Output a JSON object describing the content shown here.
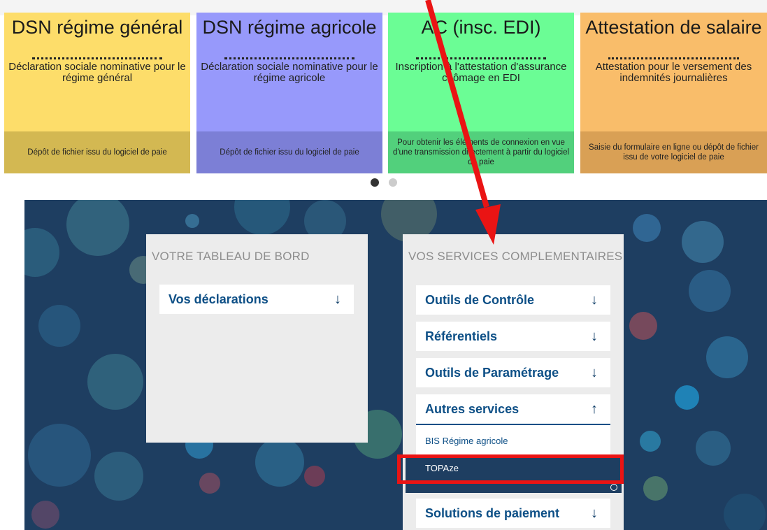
{
  "cards": [
    {
      "title": "DSN régime général",
      "desc": "Déclaration sociale nominative pour le régime général",
      "foot": "Dépôt de fichier issu du logiciel de paie"
    },
    {
      "title": "DSN régime agricole",
      "desc": "Déclaration sociale nominative pour le régime agricole",
      "foot": "Dépôt de fichier issu du logiciel de paie"
    },
    {
      "title": "AC (insc. EDI)",
      "desc": "Inscription à l'attestation d'assurance chômage en EDI",
      "foot": "Pour obtenir les éléments de connexion en vue d'une transmission directement à partir du logiciel de paie"
    },
    {
      "title": "Attestation de salaire",
      "desc": "Attestation pour le versement des indemnités journalières",
      "foot": "Saisie du formulaire en ligne ou dépôt de fichier issu de votre logiciel de paie"
    }
  ],
  "dashboard": {
    "title": "VOTRE TABLEAU DE BORD",
    "items": [
      {
        "label": "Vos déclarations",
        "arrow": "↓"
      }
    ]
  },
  "services": {
    "title": "VOS SERVICES COMPLEMENTAIRES",
    "items": [
      {
        "label": "Outils de Contrôle",
        "arrow": "↓"
      },
      {
        "label": "Référentiels",
        "arrow": "↓"
      },
      {
        "label": "Outils de Paramétrage",
        "arrow": "↓"
      },
      {
        "label": "Autres services",
        "arrow": "↑"
      },
      {
        "label": "Solutions de paiement",
        "arrow": "↓"
      }
    ],
    "subitems": [
      {
        "label": "BIS Régime agricole"
      },
      {
        "label": "TOPAze"
      }
    ]
  },
  "colors": {
    "accent": "#0d4f86",
    "panel": "#1e3e61",
    "highlight": "#ea1414",
    "selected": "#1e3e61"
  }
}
